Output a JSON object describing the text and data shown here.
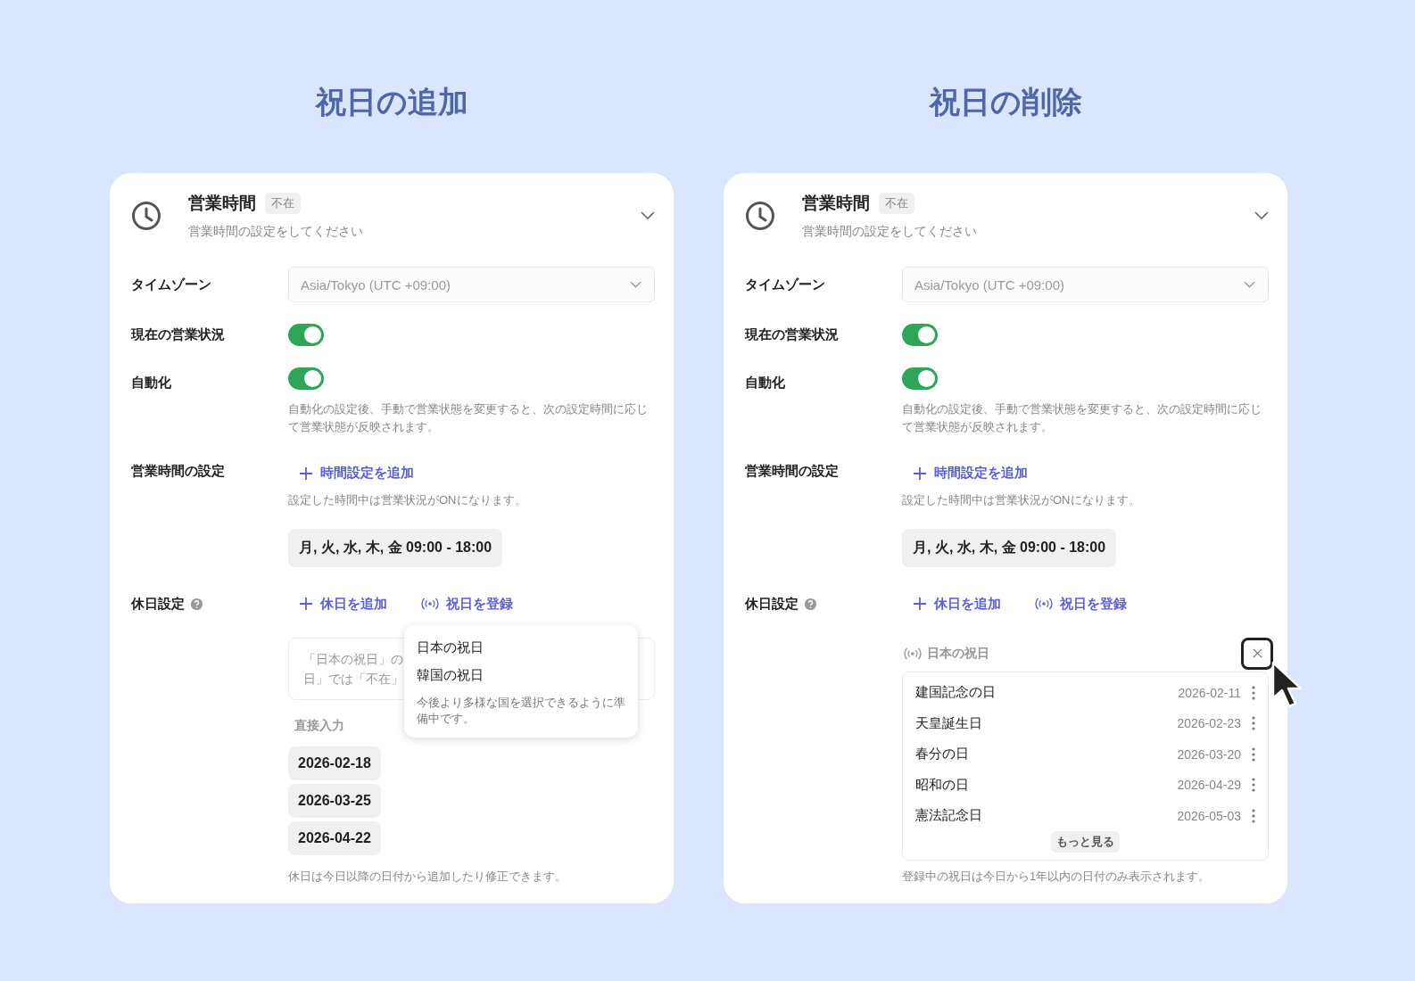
{
  "panels": [
    {
      "heading": "祝日の追加",
      "card": {
        "title": "営業時間",
        "badge": "不在",
        "subtitle": "営業時間の設定をしてください",
        "timezone": {
          "label": "タイムゾーン",
          "value": "Asia/Tokyo (UTC +09:00)"
        },
        "status": {
          "label": "現在の営業状況",
          "on": true
        },
        "automation": {
          "label": "自動化",
          "on": true,
          "description": "自動化の設定後、手動で営業状態を変更すると、次の設定時間に応じて営業状態が反映されます。"
        },
        "hours": {
          "label": "営業時間の設定",
          "add": "時間設定を追加",
          "hint": "設定した時間中は営業状況がONになります。",
          "schedules": [
            "月, 火, 水, 木, 金 09:00 - 18:00"
          ]
        },
        "holidays": {
          "label": "休日設定",
          "actions": [
            {
              "kind": "add",
              "label": "休日を追加"
            },
            {
              "kind": "broadcast",
              "label": "祝日を登録"
            }
          ],
          "kind": "menu",
          "menu": {
            "items": [
              "日本の祝日",
              "韓国の祝日"
            ],
            "note": "今後より多様な国を選択できるように準備中です。"
          },
          "notice_fragments": [
            "「日本の祝日」の",
            "日」では「不在」"
          ],
          "direct_label": "直接入力",
          "dates": [
            "2026-02-18",
            "2026-03-25",
            "2026-04-22"
          ],
          "footnote": "休日は今日以降の日付から追加したり修正できます。"
        }
      }
    },
    {
      "heading": "祝日の削除",
      "card": {
        "title": "営業時間",
        "badge": "不在",
        "subtitle": "営業時間の設定をしてください",
        "timezone": {
          "label": "タイムゾーン",
          "value": "Asia/Tokyo (UTC +09:00)"
        },
        "status": {
          "label": "現在の営業状況",
          "on": true
        },
        "automation": {
          "label": "自動化",
          "on": true,
          "description": "自動化の設定後、手動で営業状態を変更すると、次の設定時間に応じて営業状態が反映されます。"
        },
        "hours": {
          "label": "営業時間の設定",
          "add": "時間設定を追加",
          "hint": "設定した時間中は営業状況がONになります。",
          "schedules": [
            "月, 火, 水, 木, 金 09:00 - 18:00"
          ]
        },
        "holidays": {
          "label": "休日設定",
          "actions": [
            {
              "kind": "add",
              "label": "休日を追加"
            },
            {
              "kind": "broadcast",
              "label": "祝日を登録"
            }
          ],
          "kind": "registered",
          "source": "日本の祝日",
          "items": [
            {
              "name": "建国記念の日",
              "date": "2026-02-11"
            },
            {
              "name": "天皇誕生日",
              "date": "2026-02-23"
            },
            {
              "name": "春分の日",
              "date": "2026-03-20"
            },
            {
              "name": "昭和の日",
              "date": "2026-04-29"
            },
            {
              "name": "憲法記念日",
              "date": "2026-05-03"
            }
          ],
          "more": "もっと見る",
          "footnote": "登録中の祝日は今日から1年以内の日付のみ表示されます。"
        }
      }
    }
  ]
}
